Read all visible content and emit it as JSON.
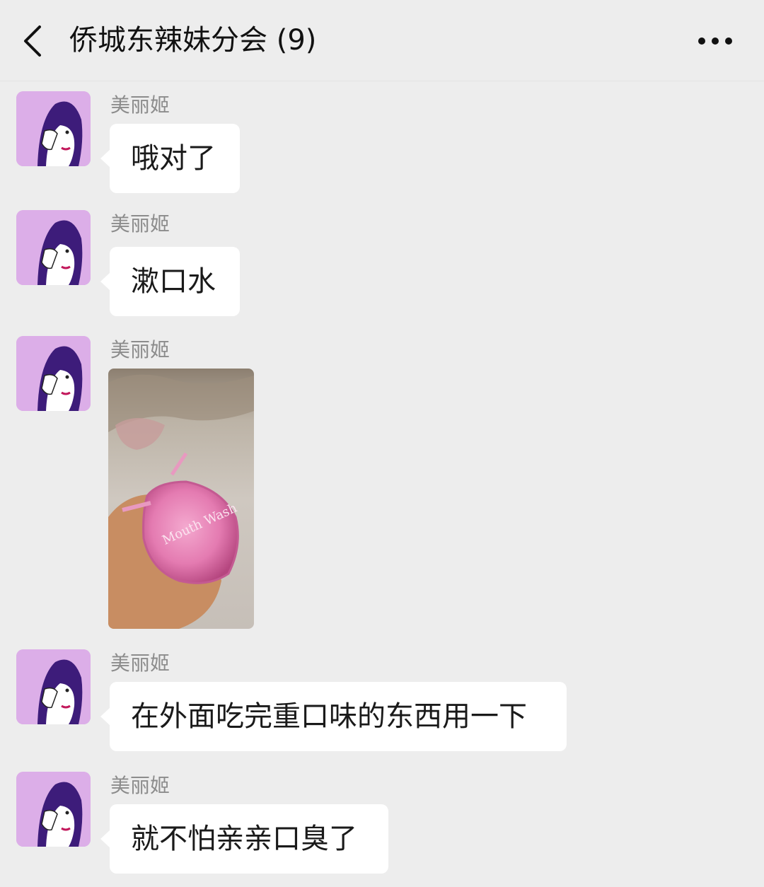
{
  "header": {
    "title": "侨城东辣妹分会 (9)",
    "back_icon": "chevron-left-icon",
    "more_icon": "more-dots-icon"
  },
  "messages": [
    {
      "sender": "美丽姬",
      "type": "text",
      "text": "哦对了"
    },
    {
      "sender": "美丽姬",
      "type": "text",
      "text": "漱口水"
    },
    {
      "sender": "美丽姬",
      "type": "image",
      "image_text": "Mouth Wash"
    },
    {
      "sender": "美丽姬",
      "type": "text",
      "text": "在外面吃完重口味的东西用一下"
    },
    {
      "sender": "美丽姬",
      "type": "text",
      "text": "就不怕亲亲口臭了"
    }
  ],
  "colors": {
    "background": "#ededed",
    "bubble": "#ffffff",
    "sender_name": "#8c8c8c",
    "avatar_bg": "#dcaee8"
  }
}
